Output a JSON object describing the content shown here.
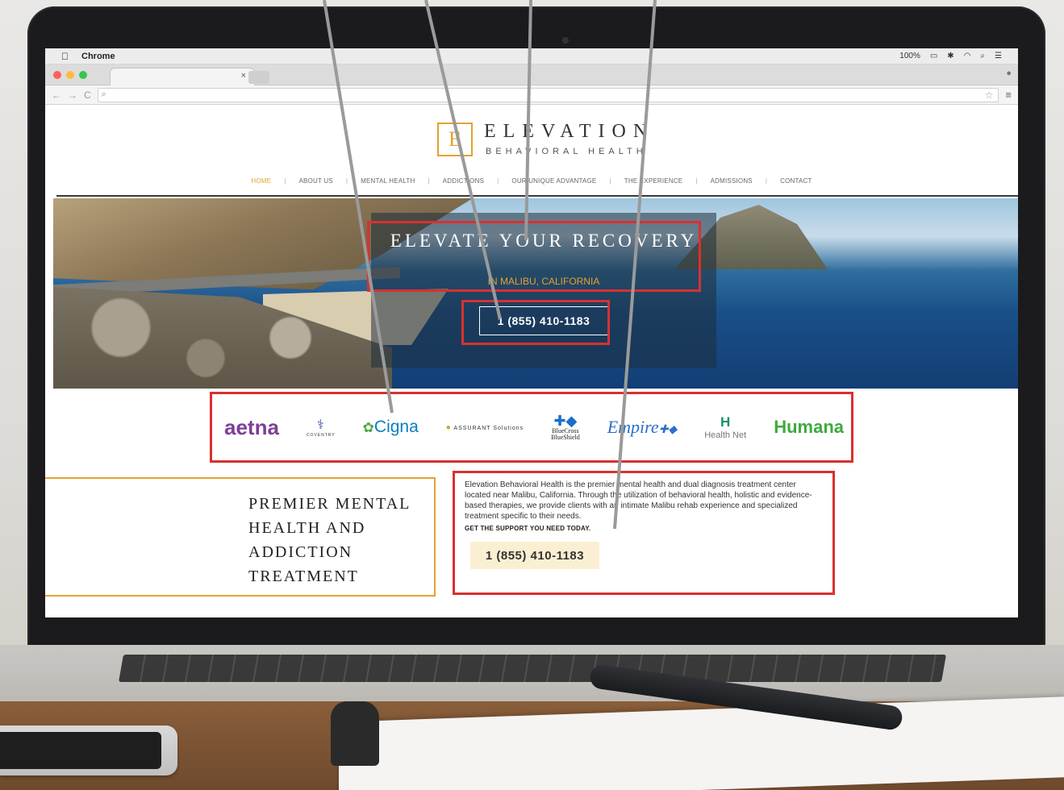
{
  "menubar": {
    "app_name": "Chrome",
    "status": "100%"
  },
  "browser": {
    "tab_close": "×",
    "search_glyph": "⌕"
  },
  "site": {
    "logo_letter": "E",
    "logo_name": "ELEVATION",
    "logo_sub": "BEHAVIORAL HEALTH",
    "nav": [
      {
        "label": "HOME",
        "active": true
      },
      {
        "label": "ABOUT US"
      },
      {
        "label": "MENTAL HEALTH"
      },
      {
        "label": "ADDICTIONS"
      },
      {
        "label": "OUR UNIQUE ADVANTAGE"
      },
      {
        "label": "THE EXPERIENCE"
      },
      {
        "label": "ADMISSIONS"
      },
      {
        "label": "CONTACT"
      }
    ],
    "hero": {
      "title": "ELEVATE YOUR RECOVERY",
      "subtitle": "IN MALIBU, CALIFORNIA",
      "phone": "1 (855) 410-1183"
    },
    "insurers": {
      "aetna": "aetna",
      "coventry": "COVENTRY",
      "cigna": "Cigna",
      "assurant": "ASSURANT Solutions",
      "bcbs_line1": "BlueCross",
      "bcbs_line2": "BlueShield",
      "empire": "Empire",
      "healthnet": "Health Net",
      "humana": "Humana"
    },
    "premier_title": "PREMIER MENTAL HEALTH AND ADDICTION TREATMENT",
    "description": "Elevation Behavioral Health is the premier mental health and dual diagnosis treatment center located near Malibu, California. Through the utilization of behavioral health, holistic and evidence-based therapies, we provide clients with an intimate Malibu rehab experience and specialized treatment specific to their needs.",
    "cta": "GET THE SUPPORT YOU NEED TODAY.",
    "cta_phone": "1 (855) 410-1183"
  },
  "colors": {
    "accent": "#e3a231",
    "annotation": "#d8312f",
    "pointer": "#9a9a9a"
  }
}
